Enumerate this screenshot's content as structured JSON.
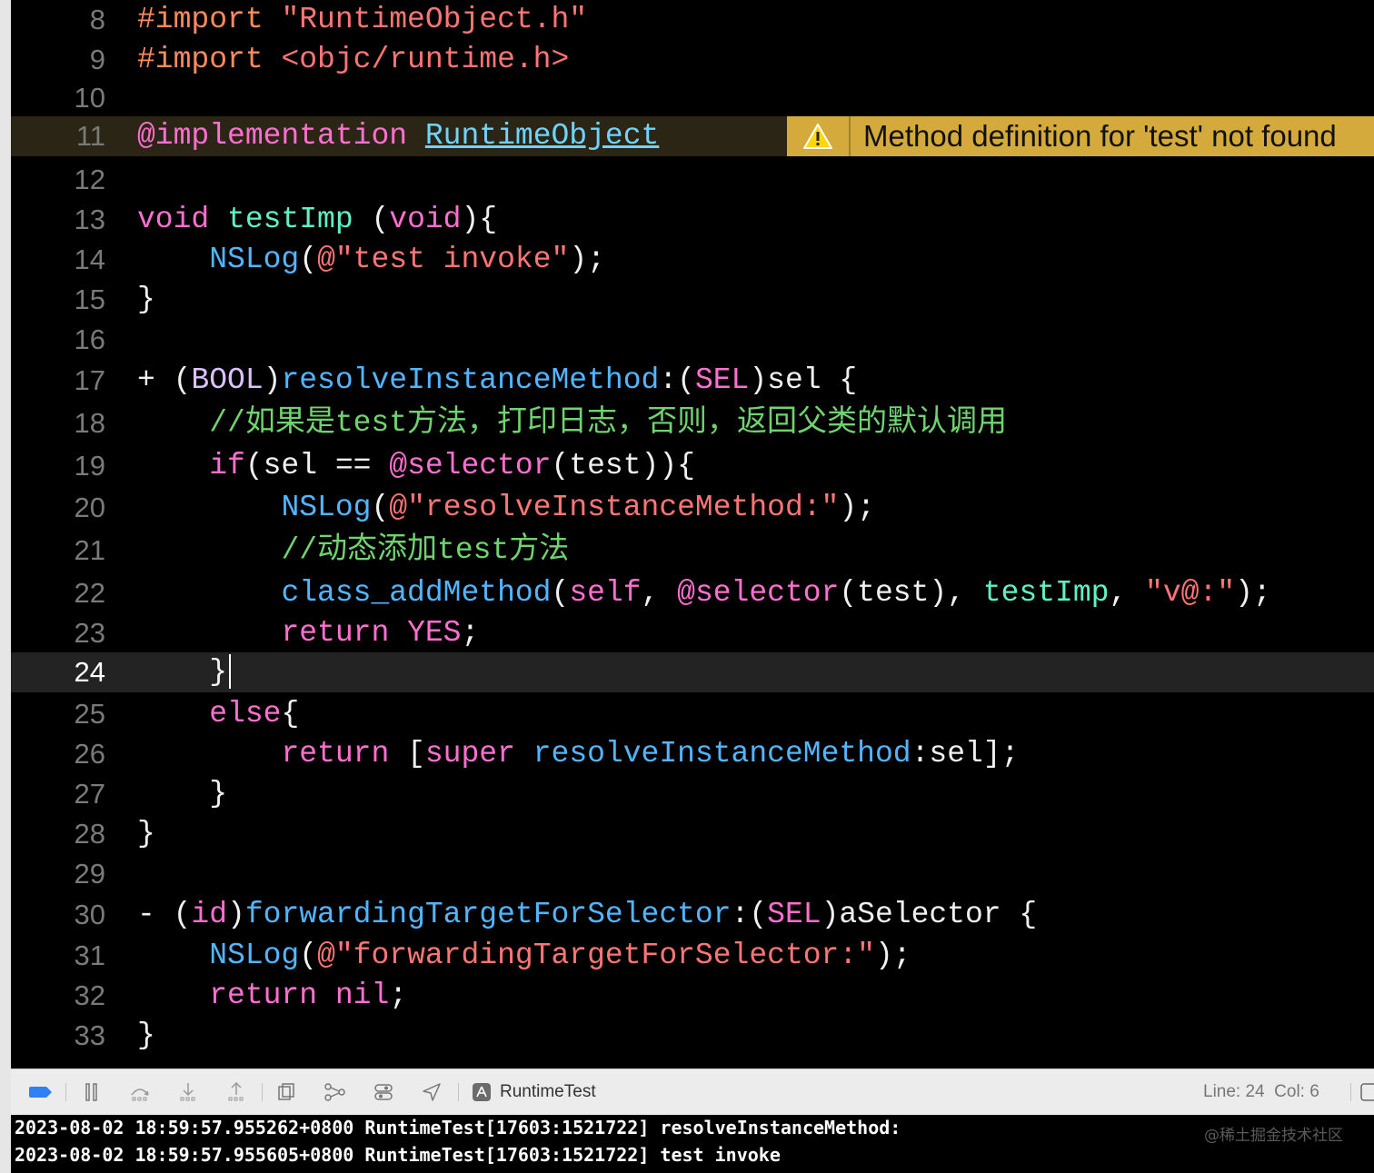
{
  "editor": {
    "lines": [
      {
        "number": "8",
        "tokens": [
          {
            "t": "#import ",
            "c": "pp"
          },
          {
            "t": "\"RuntimeObject.h\"",
            "c": "str"
          }
        ]
      },
      {
        "number": "9",
        "tokens": [
          {
            "t": "#import ",
            "c": "pp"
          },
          {
            "t": "<objc/runtime.h>",
            "c": "str"
          }
        ]
      },
      {
        "number": "10",
        "tokens": []
      },
      {
        "number": "11",
        "tokens": [
          {
            "t": "@implementation",
            "c": "kw"
          },
          {
            "t": " "
          },
          {
            "t": "RuntimeObject",
            "c": "cls"
          }
        ]
      },
      {
        "number": "12",
        "tokens": []
      },
      {
        "number": "13",
        "tokens": [
          {
            "t": "void",
            "c": "kw"
          },
          {
            "t": " "
          },
          {
            "t": "testImp",
            "c": "fn"
          },
          {
            "t": " ("
          },
          {
            "t": "void",
            "c": "kw"
          },
          {
            "t": "){"
          }
        ]
      },
      {
        "number": "14",
        "tokens": [
          {
            "t": "    "
          },
          {
            "t": "NSLog",
            "c": "mth"
          },
          {
            "t": "("
          },
          {
            "t": "@\"test invoke\"",
            "c": "str"
          },
          {
            "t": ");"
          }
        ]
      },
      {
        "number": "15",
        "tokens": [
          {
            "t": "}"
          }
        ]
      },
      {
        "number": "16",
        "tokens": []
      },
      {
        "number": "17",
        "tokens": [
          {
            "t": "+ ("
          },
          {
            "t": "BOOL",
            "c": "lm"
          },
          {
            "t": ")"
          },
          {
            "t": "resolveInstanceMethod",
            "c": "mth"
          },
          {
            "t": ":("
          },
          {
            "t": "SEL",
            "c": "kw"
          },
          {
            "t": ")sel {"
          }
        ]
      },
      {
        "number": "18",
        "tokens": [
          {
            "t": "    "
          },
          {
            "t": "//如果是test方法，打印日志，否则，返回父类的默认调用",
            "c": "cm"
          }
        ]
      },
      {
        "number": "19",
        "tokens": [
          {
            "t": "    "
          },
          {
            "t": "if",
            "c": "kw"
          },
          {
            "t": "(sel == "
          },
          {
            "t": "@selector",
            "c": "kw"
          },
          {
            "t": "(test)){"
          }
        ]
      },
      {
        "number": "20",
        "tokens": [
          {
            "t": "        "
          },
          {
            "t": "NSLog",
            "c": "mth"
          },
          {
            "t": "("
          },
          {
            "t": "@\"resolveInstanceMethod:\"",
            "c": "str"
          },
          {
            "t": ");"
          }
        ]
      },
      {
        "number": "21",
        "tokens": [
          {
            "t": "        "
          },
          {
            "t": "//动态添加test方法",
            "c": "cm"
          }
        ]
      },
      {
        "number": "22",
        "tokens": [
          {
            "t": "        "
          },
          {
            "t": "class_addMethod",
            "c": "mth"
          },
          {
            "t": "("
          },
          {
            "t": "self",
            "c": "kw"
          },
          {
            "t": ", "
          },
          {
            "t": "@selector",
            "c": "kw"
          },
          {
            "t": "(test), "
          },
          {
            "t": "testImp",
            "c": "fn"
          },
          {
            "t": ", "
          },
          {
            "t": "\"v@:\"",
            "c": "str"
          },
          {
            "t": ");"
          }
        ]
      },
      {
        "number": "23",
        "tokens": [
          {
            "t": "        "
          },
          {
            "t": "return",
            "c": "kw"
          },
          {
            "t": " "
          },
          {
            "t": "YES",
            "c": "kw"
          },
          {
            "t": ";"
          }
        ]
      },
      {
        "number": "24",
        "tokens": [
          {
            "t": "    }"
          }
        ]
      },
      {
        "number": "25",
        "tokens": [
          {
            "t": "    "
          },
          {
            "t": "else",
            "c": "kw"
          },
          {
            "t": "{"
          }
        ]
      },
      {
        "number": "26",
        "tokens": [
          {
            "t": "        "
          },
          {
            "t": "return",
            "c": "kw"
          },
          {
            "t": " ["
          },
          {
            "t": "super",
            "c": "kw"
          },
          {
            "t": " "
          },
          {
            "t": "resolveInstanceMethod",
            "c": "mth"
          },
          {
            "t": ":sel];"
          }
        ]
      },
      {
        "number": "27",
        "tokens": [
          {
            "t": "    }"
          }
        ]
      },
      {
        "number": "28",
        "tokens": [
          {
            "t": "}"
          }
        ]
      },
      {
        "number": "29",
        "tokens": []
      },
      {
        "number": "30",
        "tokens": [
          {
            "t": "- ("
          },
          {
            "t": "id",
            "c": "kw"
          },
          {
            "t": ")"
          },
          {
            "t": "forwardingTargetForSelector",
            "c": "mth"
          },
          {
            "t": ":("
          },
          {
            "t": "SEL",
            "c": "kw"
          },
          {
            "t": ")aSelector {"
          }
        ]
      },
      {
        "number": "31",
        "tokens": [
          {
            "t": "    "
          },
          {
            "t": "NSLog",
            "c": "mth"
          },
          {
            "t": "("
          },
          {
            "t": "@\"forwardingTargetForSelector:\"",
            "c": "str"
          },
          {
            "t": ");"
          }
        ]
      },
      {
        "number": "32",
        "tokens": [
          {
            "t": "    "
          },
          {
            "t": "return",
            "c": "kw"
          },
          {
            "t": " "
          },
          {
            "t": "nil",
            "c": "kw"
          },
          {
            "t": ";"
          }
        ]
      },
      {
        "number": "33",
        "tokens": [
          {
            "t": "}"
          }
        ]
      }
    ],
    "warning_line": "11",
    "current_line": "24",
    "warning_text": "Method definition for 'test' not found",
    "warning_color": "#d3aa3b",
    "syntax_colors": {
      "preprocessor": "#ff8a5c",
      "keyword": "#ff6fd0",
      "string": "#ff7474",
      "class": "#70d3ff",
      "function": "#5ff2c6",
      "method": "#52b5ff",
      "comment": "#6fd36f"
    }
  },
  "toolbar": {
    "scheme_name": "RuntimeTest",
    "line_col": "Line: 24  Col: 6",
    "icons": [
      "breakpoints-toggle-icon",
      "pause-icon",
      "step-over-icon",
      "step-into-icon",
      "step-out-icon",
      "view-hierarchy-icon",
      "memory-graph-icon",
      "environment-overrides-icon",
      "simulate-location-icon",
      "app-icon"
    ]
  },
  "console": {
    "lines": [
      "2023-08-02 18:59:57.955262+0800 RuntimeTest[17603:1521722] resolveInstanceMethod:",
      "2023-08-02 18:59:57.955605+0800 RuntimeTest[17603:1521722] test invoke"
    ],
    "watermark": "@稀土掘金技术社区"
  }
}
